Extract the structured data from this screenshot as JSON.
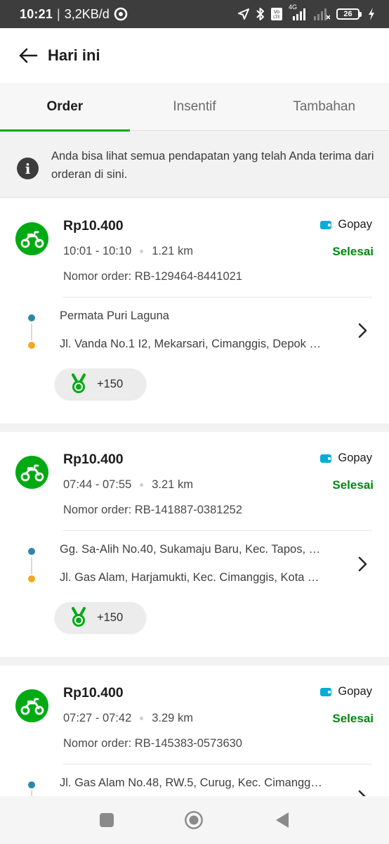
{
  "statusbar": {
    "time": "10:21",
    "separator": "|",
    "speed": "3,2KB/d",
    "network": "4G",
    "battery": "26"
  },
  "appbar": {
    "title": "Hari ini"
  },
  "tabs": [
    {
      "label": "Order",
      "active": true
    },
    {
      "label": "Insentif",
      "active": false
    },
    {
      "label": "Tambahan",
      "active": false
    }
  ],
  "info": {
    "text": "Anda bisa lihat semua pendapatan yang telah Anda terima dari orderan di sini."
  },
  "orders": [
    {
      "price": "Rp10.400",
      "time": "10:01 - 10:10",
      "distance": "1.21 km",
      "order_number": "Nomor order: RB-129464-8441021",
      "payment": "Gopay",
      "status": "Selesai",
      "pickup": "Permata Puri Laguna",
      "dropoff": "Jl. Vanda No.1 I2, Mekarsari, Cimanggis, Depok …",
      "points": "+150"
    },
    {
      "price": "Rp10.400",
      "time": "07:44 - 07:55",
      "distance": "3.21 km",
      "order_number": "Nomor order: RB-141887-0381252",
      "payment": "Gopay",
      "status": "Selesai",
      "pickup": "Gg. Sa-Alih No.40, Sukamaju Baru, Kec. Tapos, …",
      "dropoff": "Jl. Gas Alam, Harjamukti, Kec. Cimanggis, Kota …",
      "points": "+150"
    },
    {
      "price": "Rp10.400",
      "time": "07:27 - 07:42",
      "distance": "3.29 km",
      "order_number": "Nomor order: RB-145383-0573630",
      "payment": "Gopay",
      "status": "Selesai",
      "pickup": "Jl. Gas Alam No.48, RW.5, Curug, Kec. Cimangg…"
    }
  ],
  "colors": {
    "brand_green": "#00aa13",
    "status_green": "#00880f",
    "gopay_blue": "#00aed6",
    "pickup_dot": "#2e86ab",
    "dropoff_dot": "#f5a623"
  },
  "icons": {
    "back": "arrow-left-icon",
    "info": "info-icon",
    "vehicle": "scooter-icon",
    "wallet": "wallet-icon",
    "medal": "medal-icon",
    "chevron": "chevron-right-icon"
  }
}
